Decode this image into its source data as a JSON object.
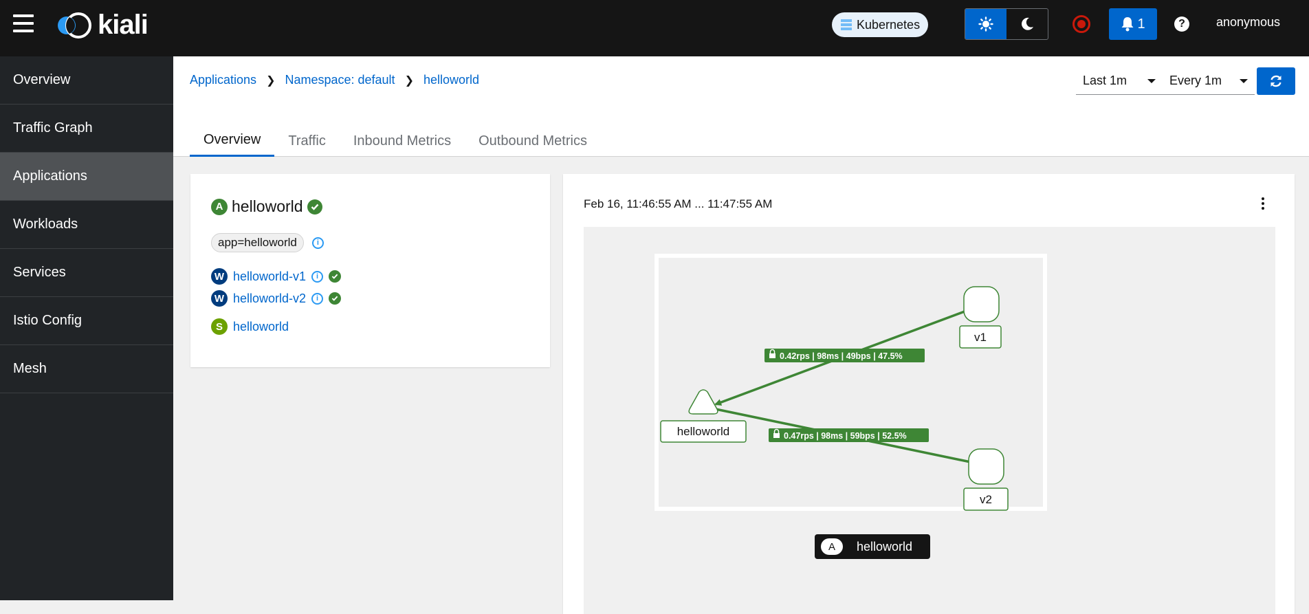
{
  "masthead": {
    "logo_text": "kiali",
    "cluster_label": "Kubernetes",
    "notification_count": "1",
    "user": "anonymous"
  },
  "sidebar": {
    "items": [
      {
        "label": "Overview"
      },
      {
        "label": "Traffic Graph"
      },
      {
        "label": "Applications"
      },
      {
        "label": "Workloads"
      },
      {
        "label": "Services"
      },
      {
        "label": "Istio Config"
      },
      {
        "label": "Mesh"
      }
    ],
    "active": "Applications"
  },
  "breadcrumb": {
    "items": [
      "Applications",
      "Namespace: default",
      "helloworld"
    ]
  },
  "toolbar": {
    "duration": "Last 1m",
    "refresh_interval": "Every 1m"
  },
  "tabs": [
    "Overview",
    "Traffic",
    "Inbound Metrics",
    "Outbound Metrics"
  ],
  "app": {
    "badge": "A",
    "name": "helloworld",
    "label": "app=helloworld",
    "workloads": [
      {
        "badge": "W",
        "name": "helloworld-v1"
      },
      {
        "badge": "W",
        "name": "helloworld-v2"
      }
    ],
    "service": {
      "badge": "S",
      "name": "helloworld"
    }
  },
  "graph": {
    "time_range": "Feb 16, 11:46:55 AM ... 11:47:55 AM",
    "nodes": {
      "app": "helloworld",
      "v1": "v1",
      "v2": "v2"
    },
    "edges": {
      "to_v1": "0.42rps | 98ms | 49bps | 47.5%",
      "to_v2": "0.47rps | 98ms | 59bps | 52.5%"
    },
    "legend": {
      "badge": "A",
      "label": "helloworld"
    },
    "colors": {
      "edge": "#3e8635",
      "node_border": "#3e8635"
    }
  }
}
